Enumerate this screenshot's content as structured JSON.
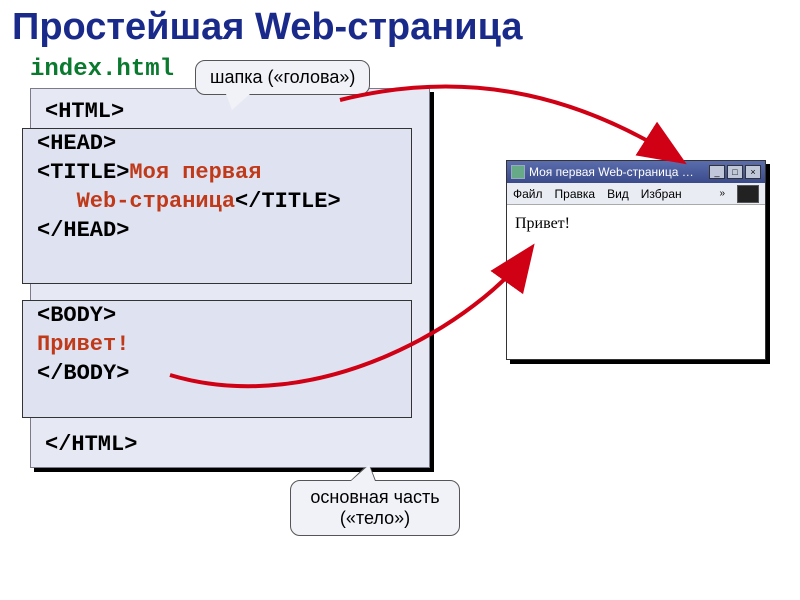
{
  "slide": {
    "title": "Простейшая Web-страница",
    "filename": "index.html"
  },
  "code": {
    "html_open": "<HTML>",
    "head_open": "<HEAD>",
    "title_open": "<TITLE>",
    "title_text1": "Моя первая",
    "title_text2_indent": "   Web-страница",
    "title_close": "</TITLE>",
    "head_close": "</HEAD>",
    "body_open": "<BODY>",
    "body_text": "Привет!",
    "body_close": "</BODY>",
    "html_close": "</HTML>"
  },
  "callouts": {
    "head": "шапка («голова»)",
    "body_line1": "основная часть",
    "body_line2": "(«тело»)"
  },
  "browser": {
    "titlebar": "Моя первая Web-страница …",
    "menu": {
      "file": "Файл",
      "edit": "Правка",
      "view": "Вид",
      "fav": "Избран",
      "chev": "»"
    },
    "content": "Привет!",
    "buttons": {
      "min": "_",
      "max": "□",
      "close": "×"
    }
  }
}
